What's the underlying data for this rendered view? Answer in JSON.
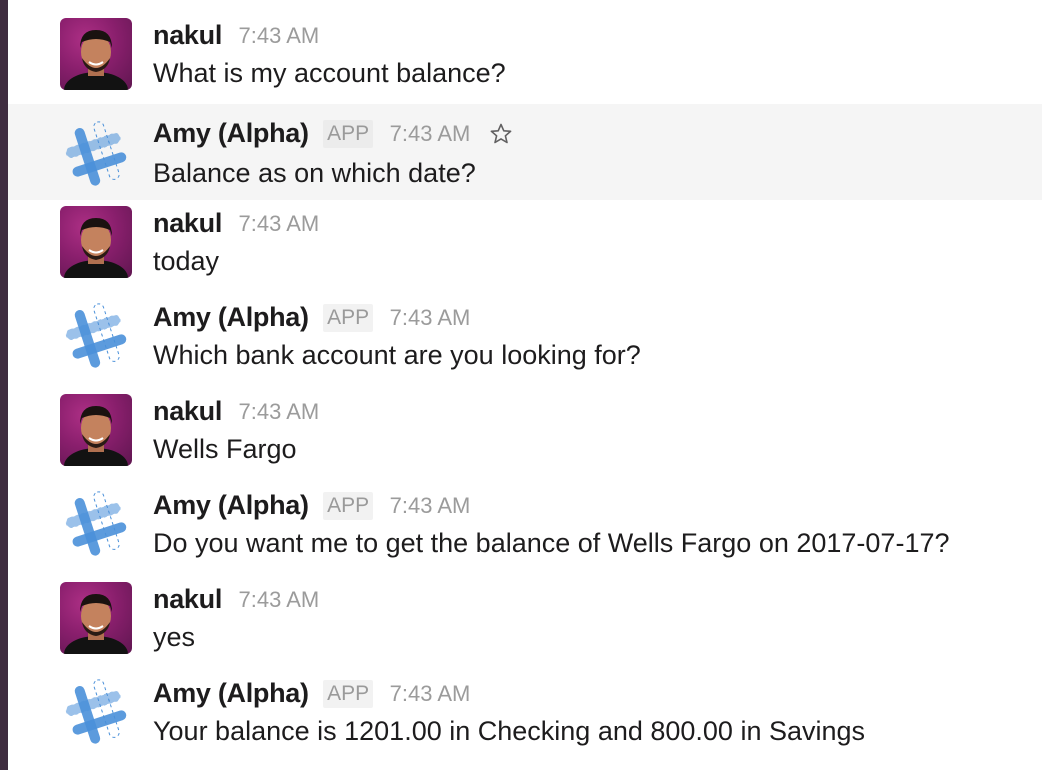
{
  "messages": [
    {
      "author": "nakul",
      "time": "7:43 AM",
      "text": "What is my account balance?",
      "type": "human"
    },
    {
      "author": "Amy (Alpha)",
      "badge": "APP",
      "time": "7:43 AM",
      "text": "Balance as on which date?",
      "type": "bot",
      "hover": true
    },
    {
      "author": "nakul",
      "time": "7:43 AM",
      "text": "today",
      "type": "human"
    },
    {
      "author": "Amy (Alpha)",
      "badge": "APP",
      "time": "7:43 AM",
      "text": "Which bank account are you looking for?",
      "type": "bot"
    },
    {
      "author": "nakul",
      "time": "7:43 AM",
      "text": "Wells Fargo",
      "type": "human"
    },
    {
      "author": "Amy (Alpha)",
      "badge": "APP",
      "time": "7:43 AM",
      "text": "Do you want me to get the balance of Wells Fargo on 2017-07-17?",
      "type": "bot"
    },
    {
      "author": "nakul",
      "time": "7:43 AM",
      "text": "yes",
      "type": "human"
    },
    {
      "author": "Amy (Alpha)",
      "badge": "APP",
      "time": "7:43 AM",
      "text": "Your balance is 1201.00 in Checking and 800.00 in Savings",
      "type": "bot"
    }
  ],
  "icons": {
    "star": "star-outline-icon",
    "human_avatar": "user-avatar",
    "bot_avatar": "bot-hashtag-avatar"
  },
  "colors": {
    "sidebar": "#3f2d40",
    "hover_row": "#f5f5f5",
    "avatar_bg": "#8a1f6d",
    "bot_blue": "#4a90d9"
  }
}
